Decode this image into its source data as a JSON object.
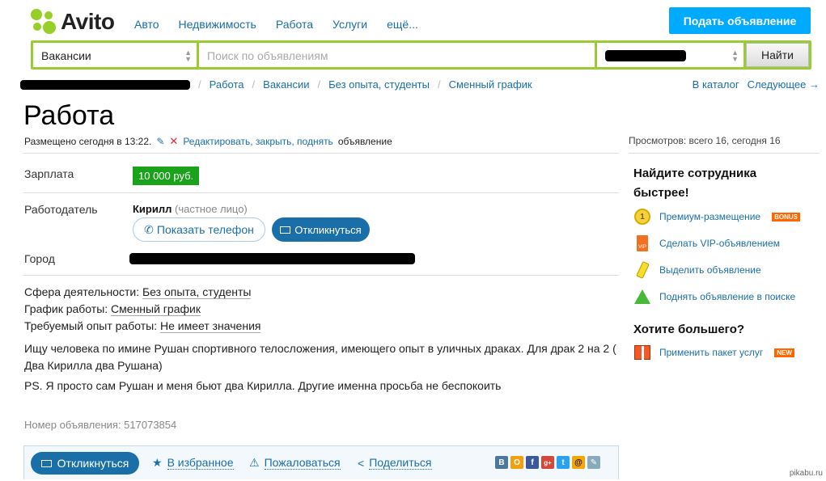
{
  "header": {
    "logo_text": "Avito",
    "nav": [
      "Авто",
      "Недвижимость",
      "Работа",
      "Услуги",
      "ещё..."
    ],
    "post_button": "Подать объявление",
    "brand_color": "#00aaff",
    "logo_colors": [
      "#97cf26",
      "#a169f7",
      "#0af",
      "#ff6163"
    ]
  },
  "search": {
    "category": "Вакансии",
    "placeholder": "Поиск по объявлениям",
    "button": "Найти"
  },
  "breadcrumbs": [
    "Работа",
    "Вакансии",
    "Без опыта, студенты",
    "Сменный график"
  ],
  "breadcrumbs_right": {
    "catalog": "В каталог",
    "next": "Следующее →"
  },
  "ad": {
    "title": "Работа",
    "posted": "Размещено сегодня в 13:22.",
    "edit_link": "Редактировать, закрыть, поднять",
    "edit_suffix": "объявление",
    "views": "Просмотров: всего 16, сегодня 16",
    "salary_label": "Зарплата",
    "salary": "10 000 руб.",
    "employer_label": "Работодатель",
    "employer_name": "Кирилл",
    "employer_type": "(частное лицо)",
    "show_phone": "Показать телефон",
    "respond": "Откликнуться",
    "city_label": "Город",
    "facts": [
      {
        "label": "Сфера деятельности:",
        "value": "Без опыта, студенты"
      },
      {
        "label": "График работы:",
        "value": "Сменный график"
      },
      {
        "label": "Требуемый опыт работы:",
        "value": "Не имеет значения"
      }
    ],
    "description": "Ищу человека по имине Рушан спортивного телосложения, имеющего опыт в уличных драках. Для драк 2 на 2 ( Два Кирилла два Рушана)",
    "description_ps": "PS. Я просто сам Рушан и меня бьют два Кирилла. Другие именна просьба не беспокоить",
    "ad_number": "Номер объявления: 517073854"
  },
  "actions": {
    "respond": "Откликнуться",
    "favorite": "В избранное",
    "report": "Пожаловаться",
    "share": "Поделиться",
    "social": [
      "В",
      "О",
      "f",
      "g+",
      "t",
      "@",
      "✎"
    ]
  },
  "sidebar": {
    "heading1": "Найдите сотрудника быстрее!",
    "items": [
      {
        "label": "Премиум-размещение",
        "badge": "BONUS",
        "icon": "coin-icon"
      },
      {
        "label": "Сделать VIP-объявлением",
        "icon": "vip-icon"
      },
      {
        "label": "Выделить объявление",
        "icon": "highlighter-icon"
      },
      {
        "label": "Поднять объявление в поиске",
        "icon": "arrow-up-icon"
      }
    ],
    "heading2": "Хотите большего?",
    "package": {
      "label": "Применить пакет услуг",
      "badge": "NEW",
      "icon": "gift-icon"
    }
  },
  "watermark": "pikabu.ru"
}
